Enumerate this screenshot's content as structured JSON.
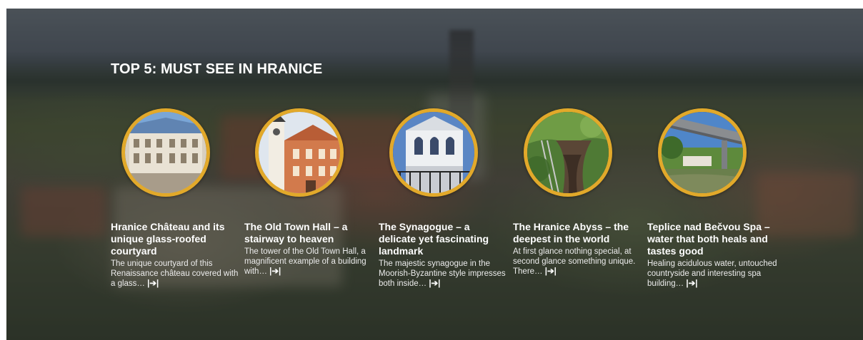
{
  "section": {
    "title": "TOP 5: MUST SEE IN HRANICE"
  },
  "cards": [
    {
      "title": "Hranice Château and its unique glass-roofed courtyard",
      "description": "The unique courtyard of this Renaissance château covered with a glass…",
      "more_label": "|➔|",
      "image_icon": "chateau-courtyard-photo"
    },
    {
      "title": "The Old Town Hall – a stairway to heaven",
      "description": "The tower of the Old Town Hall, a magnificent example of a building with…",
      "more_label": "|➔|",
      "image_icon": "town-hall-photo"
    },
    {
      "title": "The Synagogue – a delicate yet fascinating landmark",
      "description": "The majestic synagogue in the Moorish-Byzantine style impresses both inside…",
      "more_label": "|➔|",
      "image_icon": "synagogue-photo"
    },
    {
      "title": "The Hranice Abyss – the deepest in the world",
      "description": "At first glance nothing special, at second glance something unique. There…",
      "more_label": "|➔|",
      "image_icon": "abyss-photo"
    },
    {
      "title": "Teplice nad Bečvou Spa – water that both heals and tastes good",
      "description": "Healing acidulous water, untouched countryside and interesting spa building…",
      "more_label": "|➔|",
      "image_icon": "spa-bridge-photo"
    }
  ],
  "colors": {
    "ring": "#e2a92a",
    "text": "#ffffff"
  }
}
